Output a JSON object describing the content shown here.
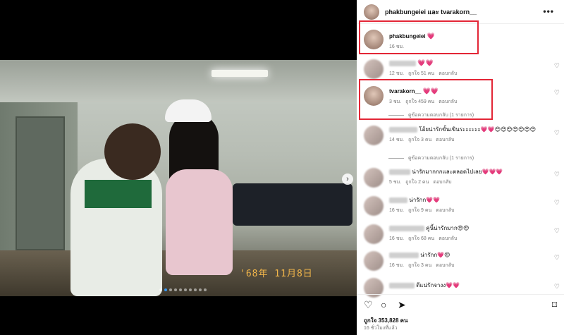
{
  "header": {
    "title": "phakbungeiei และ tvarakorn__"
  },
  "photo": {
    "date_stamp": "'68年 11月8日",
    "slide_count": 10,
    "active_slide": 1
  },
  "comments": [
    {
      "user": "phakbungeiei",
      "text": "💗",
      "meta": [
        "16 ชม."
      ],
      "blurred": false
    },
    {
      "user": "",
      "text": "💗💗",
      "meta": [
        "12 ชม.",
        "ถูกใจ 51 คน",
        "ตอบกลับ"
      ],
      "blurred": true
    },
    {
      "user": "tvarakorn__",
      "text": "💗💗",
      "meta": [
        "3 ชม.",
        "ถูกใจ 459 คน",
        "ตอบกลับ"
      ],
      "blurred": false,
      "replies": "ดูข้อความตอบกลับ (1 รายการ)"
    },
    {
      "user": "",
      "text": "โอ้ยน่ารักขั้นเขินระะะะะะ💗💗😍😍😍😍😍😍😍",
      "meta": [
        "14 ชม.",
        "ถูกใจ 3 คน",
        "ตอบกลับ"
      ],
      "blurred": true,
      "replies": "ดูข้อความตอบกลับ (1 รายการ)"
    },
    {
      "user": "",
      "text": "น่ารักมากกกและตลอดไปเลย💗💗💗",
      "meta": [
        "5 ชม.",
        "ถูกใจ 2 คน",
        "ตอบกลับ"
      ],
      "blurred": true
    },
    {
      "user": "",
      "text": "น่ารักก💗💗",
      "meta": [
        "16 ชม.",
        "ถูกใจ 9 คน",
        "ตอบกลับ"
      ],
      "blurred": true
    },
    {
      "user": "",
      "text": "คู่นี้น่ารักมาก😍😍",
      "meta": [
        "16 ชม.",
        "ถูกใจ 68 คน",
        "ตอบกลับ"
      ],
      "blurred": true
    },
    {
      "user": "",
      "text": "น่ารักก💗😍",
      "meta": [
        "16 ชม.",
        "ถูกใจ 3 คน",
        "ตอบกลับ"
      ],
      "blurred": true
    },
    {
      "user": "",
      "text": "ดีแน่รักจางง💗💗",
      "meta": [],
      "blurred": true
    }
  ],
  "footer": {
    "likes": "ถูกใจ 353,828 คน",
    "posted": "16 ชั่วโมงที่แล้ว"
  },
  "colors": {
    "highlight": "#e32636",
    "heart": "#e6245c",
    "active_dot": "#3897f0"
  }
}
